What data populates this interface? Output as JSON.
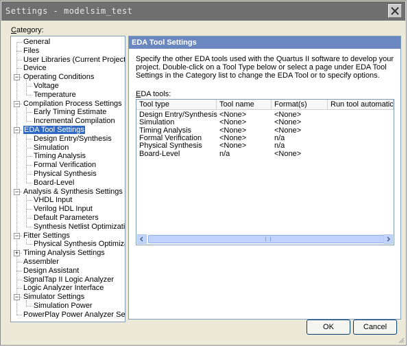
{
  "window": {
    "title": "Settings - modelsim_test"
  },
  "category": {
    "label_prefix": "C",
    "label_rest": "ategory:",
    "items": [
      {
        "label": "General",
        "level": 1,
        "expander": ""
      },
      {
        "label": "Files",
        "level": 1,
        "expander": ""
      },
      {
        "label": "User Libraries (Current Project)",
        "level": 1,
        "expander": ""
      },
      {
        "label": "Device",
        "level": 1,
        "expander": ""
      },
      {
        "label": "Operating Conditions",
        "level": 1,
        "expander": "-"
      },
      {
        "label": "Voltage",
        "level": 2,
        "expander": ""
      },
      {
        "label": "Temperature",
        "level": 2,
        "expander": ""
      },
      {
        "label": "Compilation Process Settings",
        "level": 1,
        "expander": "-"
      },
      {
        "label": "Early Timing Estimate",
        "level": 2,
        "expander": ""
      },
      {
        "label": "Incremental Compilation",
        "level": 2,
        "expander": ""
      },
      {
        "label": "EDA Tool Settings",
        "level": 1,
        "expander": "-",
        "selected": true
      },
      {
        "label": "Design Entry/Synthesis",
        "level": 2,
        "expander": ""
      },
      {
        "label": "Simulation",
        "level": 2,
        "expander": ""
      },
      {
        "label": "Timing Analysis",
        "level": 2,
        "expander": ""
      },
      {
        "label": "Formal Verification",
        "level": 2,
        "expander": ""
      },
      {
        "label": "Physical Synthesis",
        "level": 2,
        "expander": ""
      },
      {
        "label": "Board-Level",
        "level": 2,
        "expander": ""
      },
      {
        "label": "Analysis & Synthesis Settings",
        "level": 1,
        "expander": "-"
      },
      {
        "label": "VHDL Input",
        "level": 2,
        "expander": ""
      },
      {
        "label": "Verilog HDL Input",
        "level": 2,
        "expander": ""
      },
      {
        "label": "Default Parameters",
        "level": 2,
        "expander": ""
      },
      {
        "label": "Synthesis Netlist Optimizations",
        "level": 2,
        "expander": ""
      },
      {
        "label": "Fitter Settings",
        "level": 1,
        "expander": "-"
      },
      {
        "label": "Physical Synthesis Optimizations",
        "level": 2,
        "expander": ""
      },
      {
        "label": "Timing Analysis Settings",
        "level": 1,
        "expander": "+"
      },
      {
        "label": "Assembler",
        "level": 1,
        "expander": ""
      },
      {
        "label": "Design Assistant",
        "level": 1,
        "expander": ""
      },
      {
        "label": "SignalTap II Logic Analyzer",
        "level": 1,
        "expander": ""
      },
      {
        "label": "Logic Analyzer Interface",
        "level": 1,
        "expander": ""
      },
      {
        "label": "Simulator Settings",
        "level": 1,
        "expander": "-"
      },
      {
        "label": "Simulation Power",
        "level": 2,
        "expander": ""
      },
      {
        "label": "PowerPlay Power Analyzer Settings",
        "level": 1,
        "expander": ""
      }
    ]
  },
  "panel": {
    "title": "EDA Tool Settings",
    "description": "Specify the other EDA tools used with the Quartus II software to develop your project. Double-click on a Tool Type below or select a page under EDA Tool Settings in the Category list to change the EDA Tool or to specify options.",
    "eda_label_prefix": "E",
    "eda_label_rest": "DA tools:",
    "columns": [
      "Tool type",
      "Tool name",
      "Format(s)",
      "Run tool automatically"
    ],
    "rows": [
      [
        "Design Entry/Synthesis",
        "<None>",
        "<None>",
        ""
      ],
      [
        "Simulation",
        "<None>",
        "<None>",
        ""
      ],
      [
        "Timing Analysis",
        "<None>",
        "<None>",
        ""
      ],
      [
        "Formal Verification",
        "<None>",
        "n/a",
        ""
      ],
      [
        "Physical Synthesis",
        "<None>",
        "n/a",
        ""
      ],
      [
        "Board-Level",
        "n/a",
        "<None>",
        ""
      ]
    ],
    "scrollbar_position": 0
  },
  "buttons": {
    "ok": "OK",
    "cancel": "Cancel"
  },
  "colors": {
    "selection": "#316ac5",
    "panel_header": "#6b87bf",
    "titlebar": "#6f6f6f"
  }
}
